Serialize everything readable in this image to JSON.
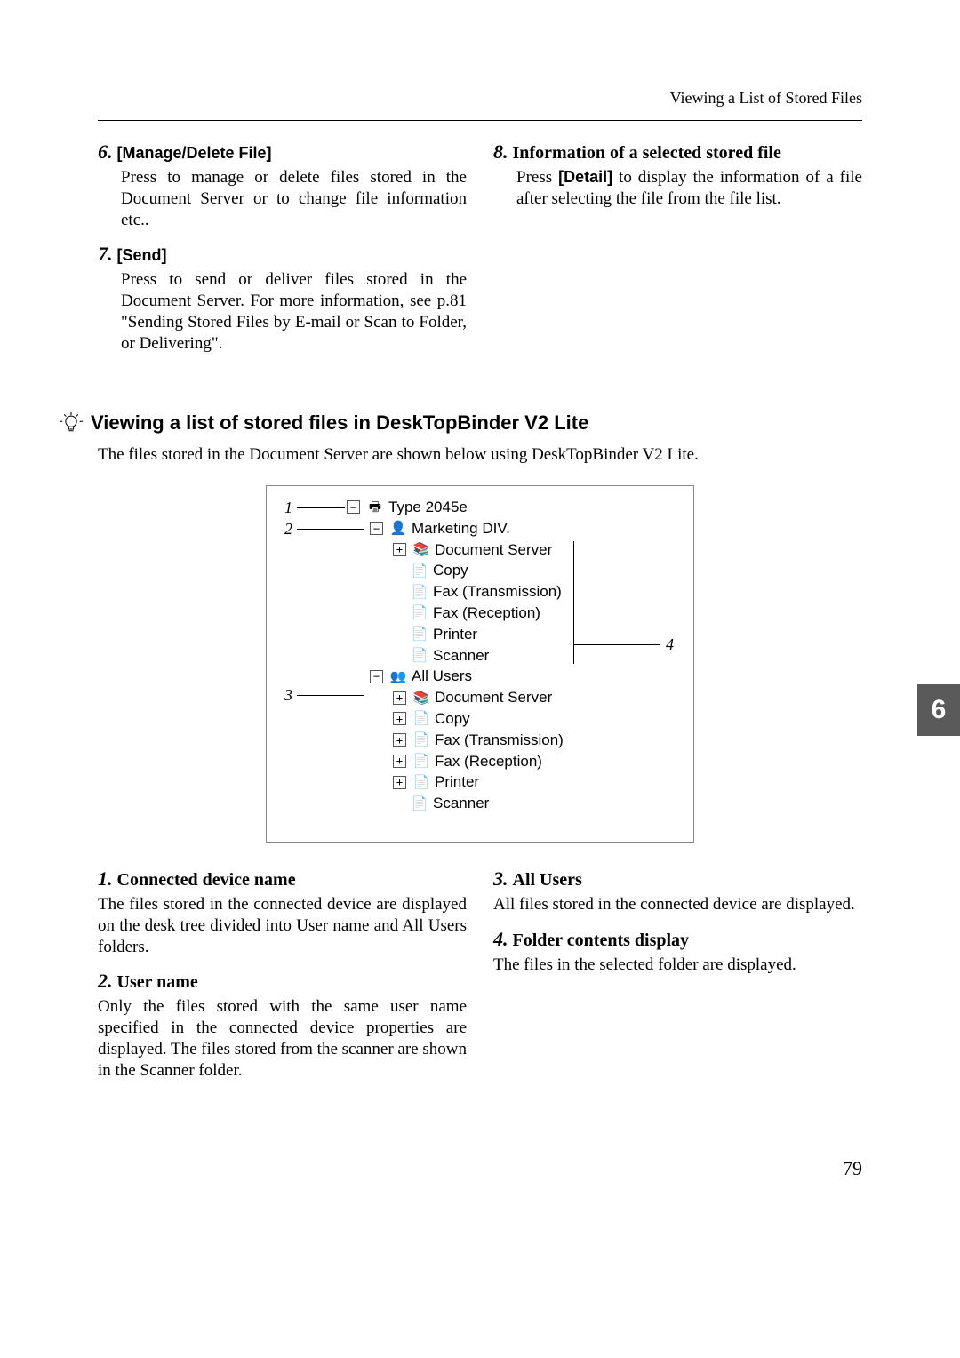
{
  "header": {
    "running": "Viewing a List of Stored Files"
  },
  "upper": {
    "left": [
      {
        "num": "6.",
        "label_style": "sans",
        "label": "[Manage/Delete File]",
        "body": "Press to manage or delete files stored in the Document Server or to change file information etc.."
      },
      {
        "num": "7.",
        "label_style": "sans",
        "label": "[Send]",
        "body": "Press to send or deliver files stored in the Document Server. For more information, see p.81 \"Sending Stored Files by E-mail or Scan to Folder, or Delivering\"."
      }
    ],
    "right": [
      {
        "num": "8.",
        "label_style": "serif",
        "label": "Information of a selected stored file",
        "body_prefix": "Press ",
        "body_bold": "[Detail]",
        "body_suffix": " to display the information of a file after selecting the file from the file list."
      }
    ]
  },
  "section": {
    "title": "Viewing a list of stored files in DeskTopBinder V2 Lite",
    "intro": "The files stored in the Document Server are shown below using DeskTopBinder V2 Lite."
  },
  "figure": {
    "callouts": {
      "c1": "1",
      "c2": "2",
      "c3": "3",
      "c4": "4"
    },
    "tree": {
      "root": "Type 2045e",
      "n1": "Marketing DIV.",
      "n1_children": [
        "Document Server",
        "Copy",
        "Fax (Transmission)",
        "Fax (Reception)",
        "Printer",
        "Scanner"
      ],
      "n2": "All Users",
      "n2_children": [
        "Document Server",
        "Copy",
        "Fax (Transmission)",
        "Fax (Reception)",
        "Printer",
        "Scanner"
      ]
    }
  },
  "lower": {
    "left": [
      {
        "num": "1.",
        "label": "Connected device name",
        "body": "The files stored in the connected device are displayed on the desk tree divided into User name and All Users folders."
      },
      {
        "num": "2.",
        "label": "User name",
        "body": "Only the files stored with the same user name specified in the connected device properties are displayed. The files stored from the scanner are shown in the Scanner folder."
      }
    ],
    "right": [
      {
        "num": "3.",
        "label": "All Users",
        "body": "All files stored in the connected device are displayed."
      },
      {
        "num": "4.",
        "label": "Folder contents display",
        "body": "The files in the selected folder are displayed."
      }
    ]
  },
  "sideTab": "6",
  "pageNumber": "79"
}
